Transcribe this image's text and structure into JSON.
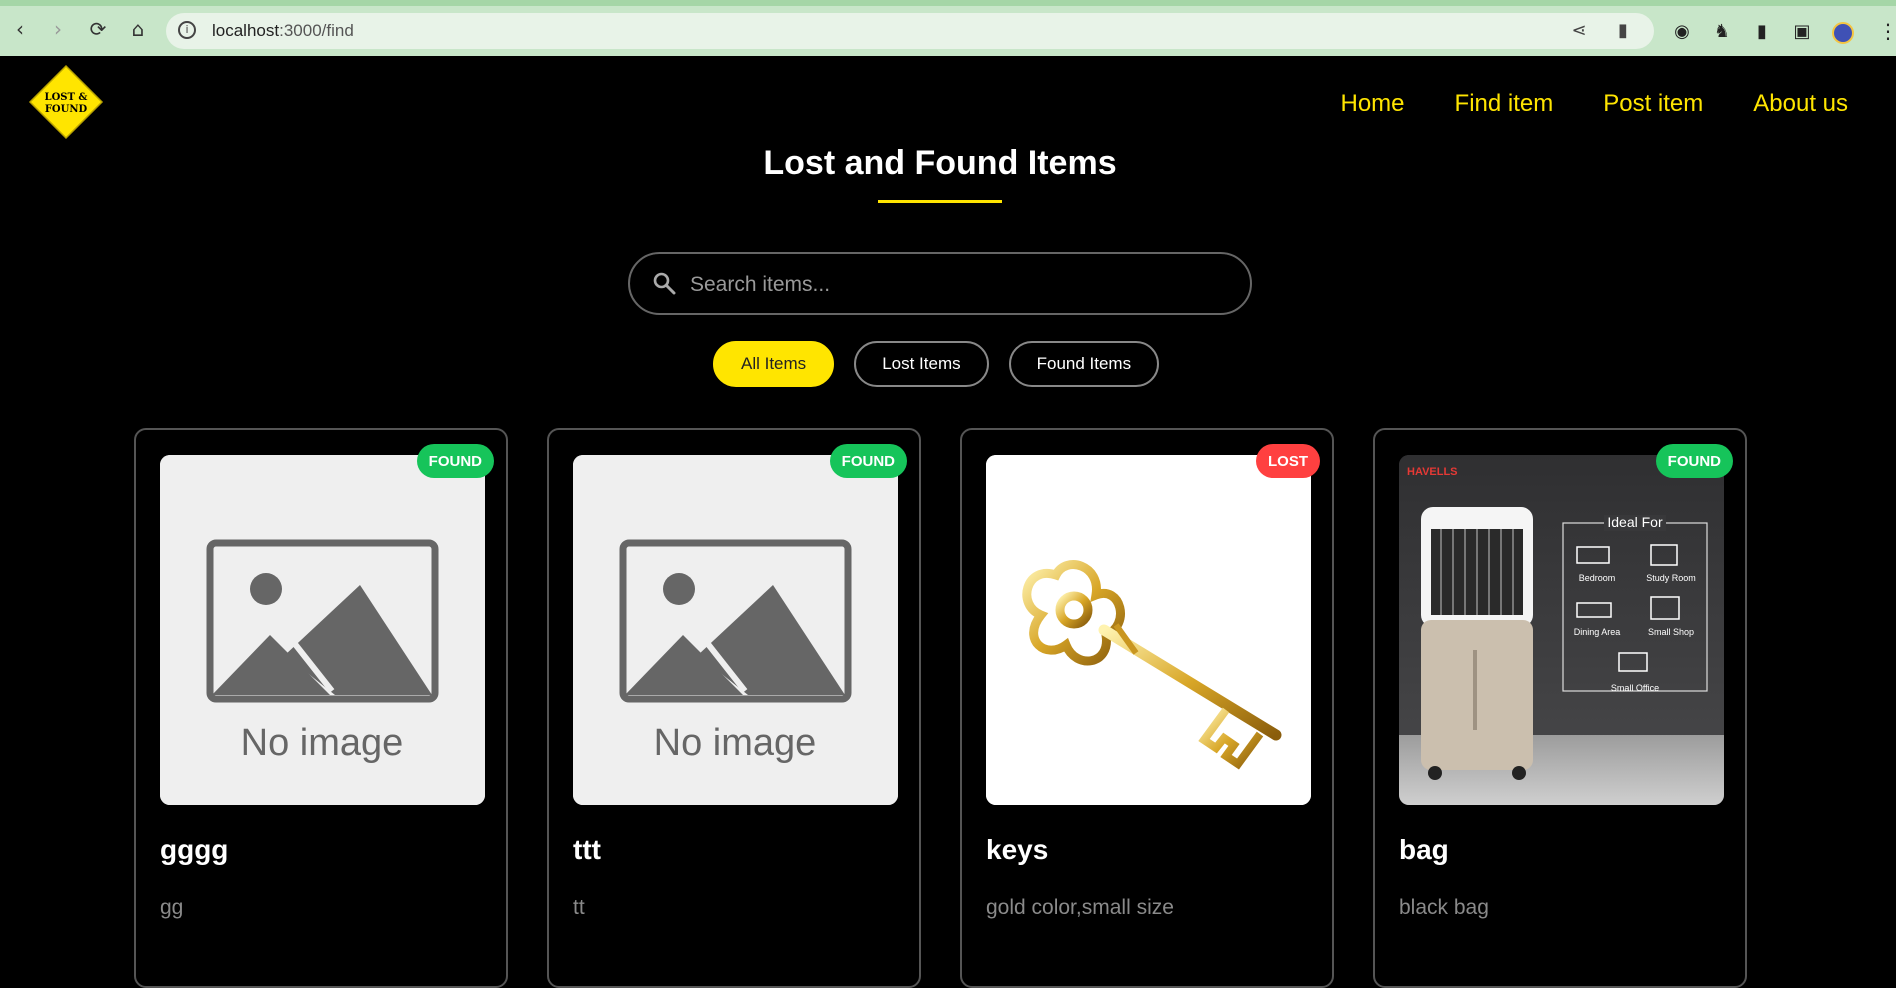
{
  "browser": {
    "url_host": "localhost",
    "url_rest": ":3000/find"
  },
  "logo": {
    "line1": "LOST &",
    "line2": "FOUND"
  },
  "nav": {
    "home": "Home",
    "find": "Find item",
    "post": "Post item",
    "about": "About us"
  },
  "page": {
    "title": "Lost and Found Items"
  },
  "search": {
    "placeholder": "Search items..."
  },
  "filters": {
    "all": "All Items",
    "lost": "Lost Items",
    "found": "Found Items"
  },
  "items": [
    {
      "name": "gggg",
      "description": "gg",
      "status": "FOUND",
      "image_text": "No image"
    },
    {
      "name": "ttt",
      "description": "tt",
      "status": "FOUND",
      "image_text": "No image"
    },
    {
      "name": "keys",
      "description": "gold color,small size",
      "status": "LOST"
    },
    {
      "name": "bag",
      "description": "black bag",
      "status": "FOUND",
      "image": {
        "brand": "HAVELLS",
        "heading": "Ideal For",
        "uses": [
          "Bedroom",
          "Study Room",
          "Dining Area",
          "Small Shop",
          "Small Office"
        ]
      }
    }
  ],
  "colors": {
    "accent": "#ffe500",
    "found": "#16c45a",
    "lost": "#ff4040",
    "background": "#000000"
  }
}
